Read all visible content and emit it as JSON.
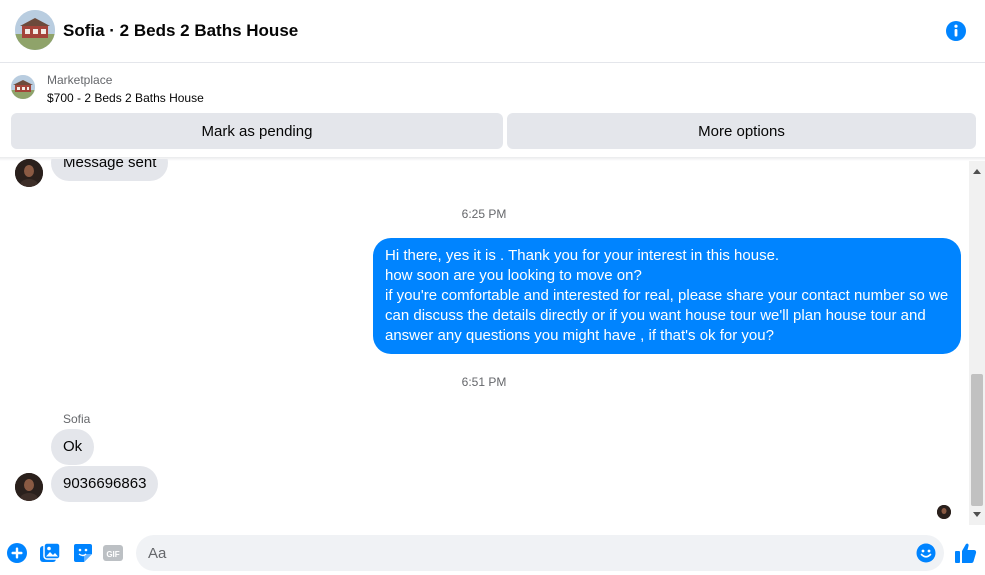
{
  "header": {
    "title": "Sofia · 2 Beds 2 Baths House",
    "avatar_icon": "house-photo-icon",
    "info_icon": "info-icon"
  },
  "marketplace": {
    "label": "Marketplace",
    "item": "$700 - 2 Beds 2 Baths House",
    "mark_pending_label": "Mark as pending",
    "more_options_label": "More options"
  },
  "messages": {
    "partial_top": "Message sent",
    "time_1": "6:25 PM",
    "outgoing_lines": [
      "Hi there, yes it is . Thank you for your interest in this house.",
      "how soon are you looking to move on?",
      "if you're comfortable and interested for real, please share your contact number so we",
      "can discuss the details directly or if you  want house tour we'll plan house tour and",
      "answer any questions you might have , if that's ok for you?"
    ],
    "time_2": "6:51 PM",
    "sender": "Sofia",
    "incoming_1": "Ok",
    "incoming_2": "9036696863"
  },
  "composer": {
    "placeholder": "Aa",
    "icons": [
      "plus-circle-icon",
      "photo-icon",
      "sticker-icon",
      "gif-icon",
      "emoji-icon",
      "thumbs-up-icon"
    ],
    "gif_label": "GIF"
  },
  "colors": {
    "accent": "#0084ff",
    "bubble_incoming": "#e4e6eb",
    "secondary_text": "#65676b"
  }
}
